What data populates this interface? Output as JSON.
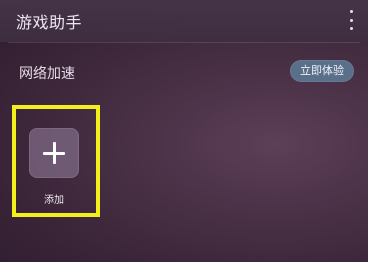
{
  "header": {
    "title": "游戏助手",
    "menu_icon": "more-vertical-icon"
  },
  "network_boost": {
    "label": "网络加速",
    "button_label": "立即体验"
  },
  "add_tile": {
    "icon": "plus-icon",
    "label": "添加"
  },
  "colors": {
    "highlight": "#f2ef1a",
    "button_bg": "#5a6f8a"
  }
}
